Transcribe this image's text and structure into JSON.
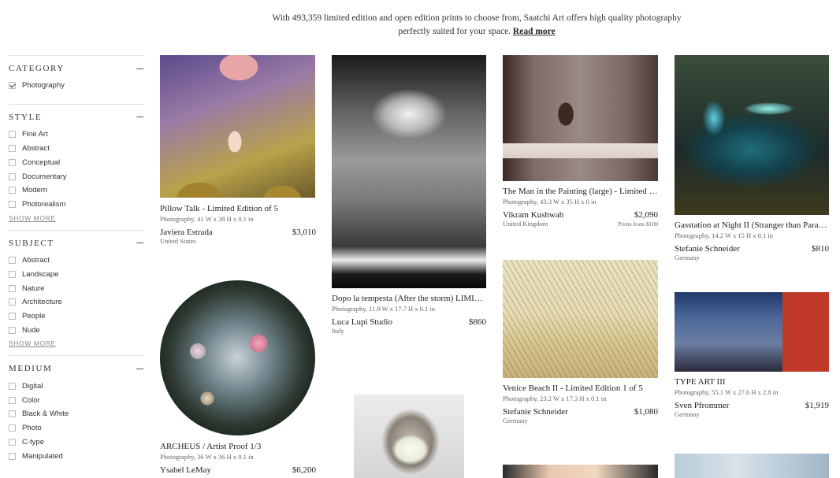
{
  "intro": {
    "text": "With 493,359 limited edition and open edition prints to choose from, Saatchi Art offers high quality photography perfectly suited for your space.",
    "read_more": "Read more"
  },
  "sidebar": {
    "category": {
      "title": "CATEGORY",
      "options": [
        {
          "label": "Photography",
          "checked": true
        }
      ]
    },
    "style": {
      "title": "STYLE",
      "options": [
        "Fine Art",
        "Abstract",
        "Conceptual",
        "Documentary",
        "Modern",
        "Photorealism"
      ],
      "show_more": "SHOW MORE"
    },
    "subject": {
      "title": "SUBJECT",
      "options": [
        "Abstract",
        "Landscape",
        "Nature",
        "Architecture",
        "People",
        "Nude"
      ],
      "show_more": "SHOW MORE"
    },
    "medium": {
      "title": "MEDIUM",
      "options": [
        "Digital",
        "Color",
        "Black & White",
        "Photo",
        "C-type",
        "Manipulated"
      ]
    }
  },
  "artworks": [
    {
      "title": "Pillow Talk - Limited Edition of 5",
      "meta": "Photography, 41 W x 38 H x 0.1 in",
      "artist": "Javiera Estrada",
      "price": "$3,010",
      "country": "United States"
    },
    {
      "title": "Dopo la tempesta (After the storm) LIMITED EDITION",
      "meta": "Photography, 11.8 W x 17.7 H x 0.1 in",
      "artist": "Luca Lupi Studio",
      "price": "$860",
      "country": "Italy"
    },
    {
      "title": "The Man in the Painting (large) - Limited Edition",
      "meta": "Photography, 43.3 W x 35 H x 0 in",
      "artist": "Vikram Kushwah",
      "price": "$2,090",
      "country": "United Kingdom",
      "prints": "Prints from $100"
    },
    {
      "title": "Gasstation at Night II (Stranger than Paradise)",
      "meta": "Photography, 14.2 W x 15 H x 0.1 in",
      "artist": "Stefanie Schneider",
      "price": "$810",
      "country": "Germany"
    },
    {
      "title": "ARCHEUS / Artist Proof 1/3",
      "meta": "Photography, 36 W x 36 H x 0.1 in",
      "artist": "Ysabel LeMay",
      "price": "$6,200"
    },
    {
      "title": "Venice Beach II - Limited Edition 1 of 5",
      "meta": "Photography, 23.2 W x 17.3 H x 0.1 in",
      "artist": "Stefanie Schneider",
      "price": "$1,080",
      "country": "Germany"
    },
    {
      "title": "TYPE ART III",
      "meta": "Photography, 55.1 W x 27.6 H x 2.8 in",
      "artist": "Sven Pfrommer",
      "price": "$1,919",
      "country": "Germany"
    }
  ]
}
